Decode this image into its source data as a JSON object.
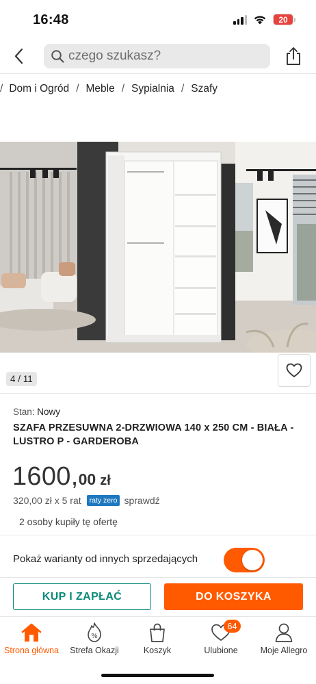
{
  "status_bar": {
    "time": "16:48",
    "battery": "20",
    "icons": [
      "signal-icon",
      "wifi-icon",
      "battery-icon"
    ]
  },
  "header": {
    "search_placeholder": "czego szukasz?",
    "icons": [
      "back-icon",
      "search-icon",
      "share-icon"
    ]
  },
  "breadcrumb": {
    "items": [
      "Dom i Ogród",
      "Meble",
      "Sypialnia",
      "Szafy"
    ]
  },
  "gallery": {
    "counter": "4 / 11",
    "icons": [
      "heart-icon"
    ]
  },
  "product": {
    "condition_label": "Stan:",
    "condition_value": "Nowy",
    "title": "SZAFA PRZESUWNA 2-DRZWIOWA 140 x 250 CM - BIAŁA - LUSTRO P - GARDEROBA",
    "price_int": "1600,",
    "price_dec": "00",
    "price_currency": "zł",
    "installment_text": "320,00 zł x 5 rat",
    "raty_badge": "raty zero",
    "installment_link": "sprawdź",
    "buyers": "2 osoby kupiły tę ofertę"
  },
  "variants": {
    "label": "Pokaż warianty od innych sprzedających",
    "toggle_on": true
  },
  "actions": {
    "buy_label": "KUP I ZAPŁAĆ",
    "cart_label": "DO KOSZYKA"
  },
  "bottom_nav": {
    "items": [
      {
        "label": "Strona główna",
        "icon": "home-icon",
        "active": true
      },
      {
        "label": "Strefa Okazji",
        "icon": "deals-icon"
      },
      {
        "label": "Koszyk",
        "icon": "cart-icon"
      },
      {
        "label": "Ulubione",
        "icon": "heart-icon",
        "badge": "64"
      },
      {
        "label": "Moje Allegro",
        "icon": "user-icon"
      }
    ]
  },
  "colors": {
    "accent": "#ff5a00",
    "teal": "#0b8a7a",
    "badge_blue": "#1d78c0"
  }
}
